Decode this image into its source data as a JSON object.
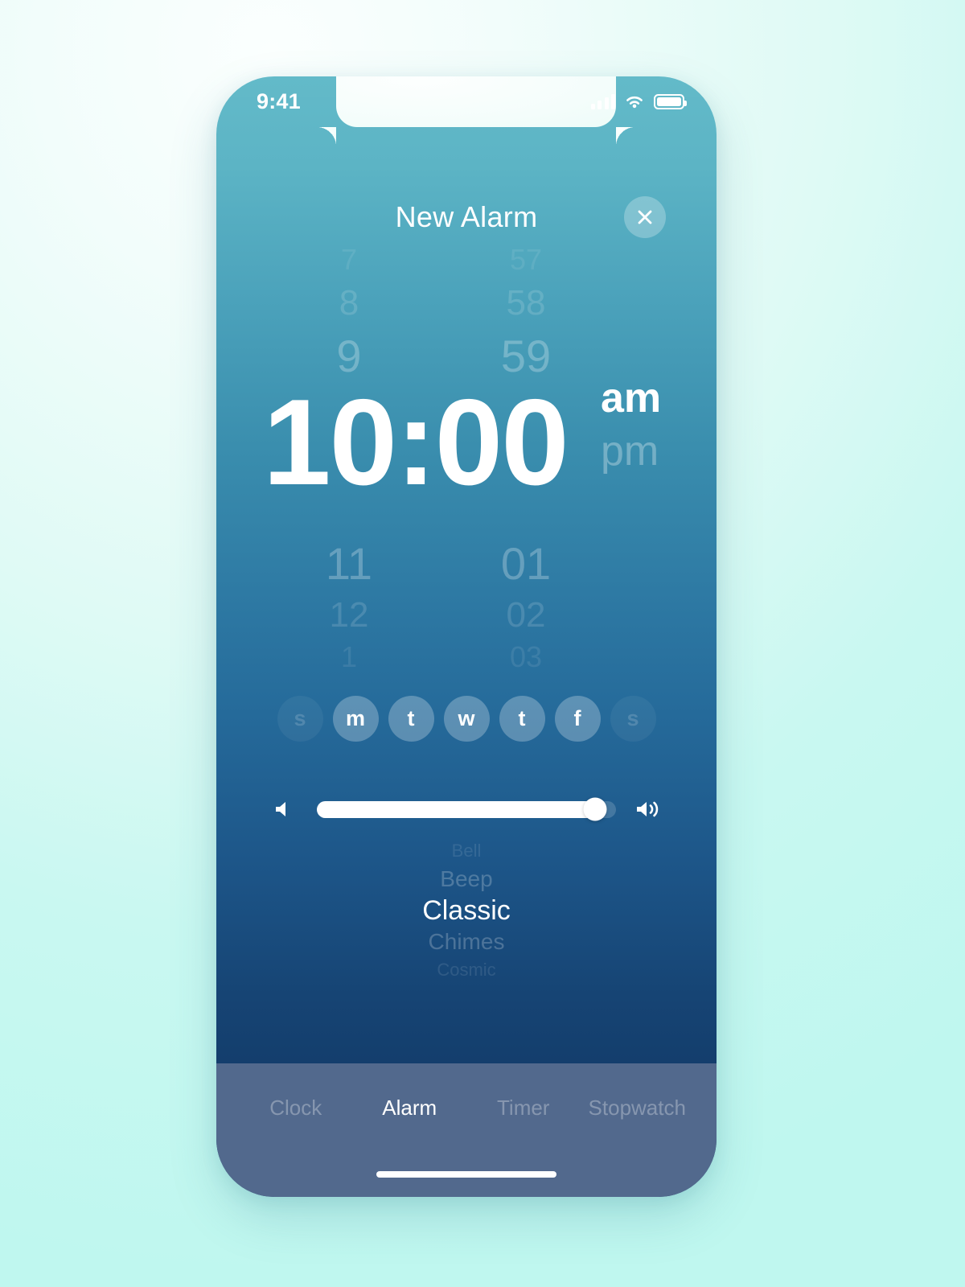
{
  "colors": {
    "screen_top": "#63bac9",
    "screen_mid": "#2e7aa4",
    "screen_bottom": "#113765",
    "tabbar": "#52698d",
    "page_background": "#c9f8f1",
    "accent_white": "#ffffff"
  },
  "status_bar": {
    "time": "9:41",
    "signal_icon": "cellular-signal-icon",
    "wifi_icon": "wifi-icon",
    "battery_icon": "battery-icon"
  },
  "header": {
    "title": "New Alarm",
    "close_icon": "close-icon"
  },
  "time_picker": {
    "hour": {
      "above": [
        "7",
        "8",
        "9"
      ],
      "selected": "10",
      "below": [
        "11",
        "12",
        "1"
      ]
    },
    "minute": {
      "above": [
        "57",
        "58",
        "59"
      ],
      "selected": "00",
      "below": [
        "01",
        "02",
        "03"
      ]
    },
    "separator": ":",
    "display_time": "10:00",
    "meridiem": {
      "selected": "am",
      "other": "pm"
    }
  },
  "repeat_days": [
    {
      "label": "s",
      "name": "sunday",
      "selected": false
    },
    {
      "label": "m",
      "name": "monday",
      "selected": true
    },
    {
      "label": "t",
      "name": "tuesday",
      "selected": true
    },
    {
      "label": "w",
      "name": "wednesday",
      "selected": true
    },
    {
      "label": "t",
      "name": "thursday",
      "selected": true
    },
    {
      "label": "f",
      "name": "friday",
      "selected": true
    },
    {
      "label": "s",
      "name": "saturday",
      "selected": false
    }
  ],
  "volume": {
    "value_percent": 93,
    "min_icon": "volume-low-icon",
    "max_icon": "volume-high-icon"
  },
  "sound_picker": {
    "above": [
      "Bell",
      "Beep"
    ],
    "selected": "Classic",
    "below": [
      "Chimes",
      "Cosmic"
    ]
  },
  "tab_bar": {
    "tabs": [
      {
        "label": "Clock",
        "active": false
      },
      {
        "label": "Alarm",
        "active": true
      },
      {
        "label": "Timer",
        "active": false
      },
      {
        "label": "Stopwatch",
        "active": false
      }
    ]
  }
}
